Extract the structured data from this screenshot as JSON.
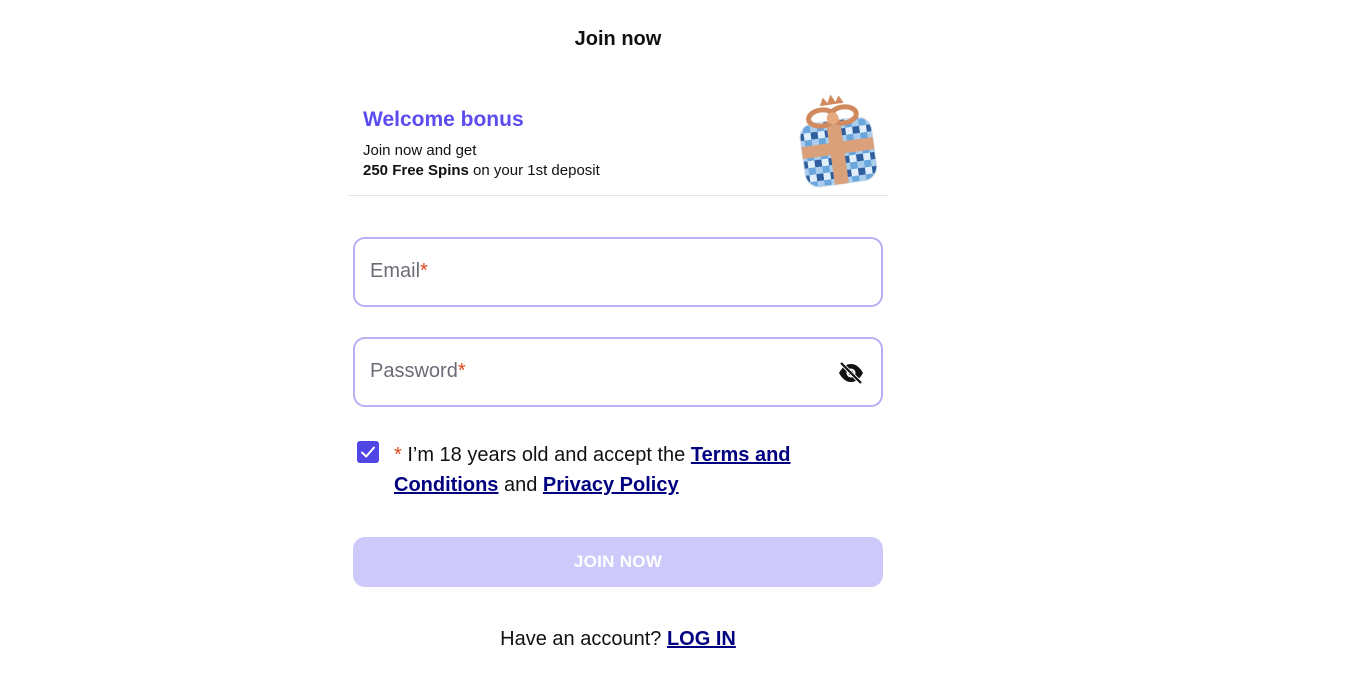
{
  "header": {
    "title": "Join now"
  },
  "bonus": {
    "heading": "Welcome bonus",
    "line1": "Join now and get",
    "highlight": "250 Free Spins",
    "line2_rest": " on your 1st deposit",
    "image_icon": "gift-box-icon"
  },
  "form": {
    "email": {
      "label": "Email",
      "required_mark": "*"
    },
    "password": {
      "label": "Password",
      "required_mark": "*",
      "toggle_icon": "eye-slash-icon"
    },
    "consent": {
      "checked": true,
      "required_mark": "* ",
      "text_before": "I’m 18 years old and accept the ",
      "terms_link": "Terms and Conditions",
      "text_middle": " and ",
      "privacy_link": "Privacy Policy"
    },
    "submit_label": "JOIN NOW"
  },
  "footer": {
    "prompt": "Have an account? ",
    "login_link": "LOG IN"
  },
  "colors": {
    "accent": "#5b4cf0",
    "field_border": "#b7b1f2",
    "button_disabled": "#cdc9fb",
    "checkbox": "#4f46e5",
    "required": "#e2461c",
    "link": "#000080"
  }
}
